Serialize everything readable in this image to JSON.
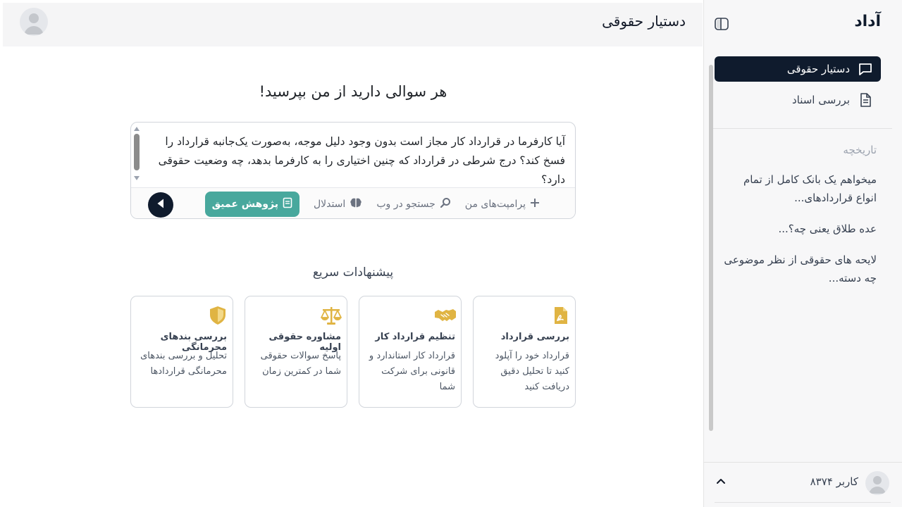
{
  "sidebar": {
    "brand": "آداد",
    "nav": [
      {
        "label": "دستیار حقوقی",
        "icon": "chat-icon",
        "active": true
      },
      {
        "label": "بررسی اسناد",
        "icon": "document-icon",
        "active": false
      }
    ],
    "history_title": "تاریخچه",
    "history": [
      "میخواهم یک بانک کامل از تمام انواع قراردادهای...",
      "عده طلاق یعنی چه؟...",
      "لایحه های حقوقی از نظر موضوعی چه دسته..."
    ],
    "user": {
      "name": "کاربر ۸۳۷۴"
    }
  },
  "header": {
    "title": "دستیار حقوقی"
  },
  "main": {
    "heading": "هر سوالی دارید از من بپرسید!",
    "composer": {
      "text": "آیا کارفرما در قرارداد کار مجاز است بدون وجود دلیل موجه، به‌صورت یک‌جانبه قرارداد را فسخ کند؟ درج شرطی در قرارداد که چنین اختیاری را به کارفرما بدهد، چه وضعیت حقوقی دارد؟",
      "tools": {
        "prompts": "پرامپت‌های من",
        "web_search": "جستجو در وب",
        "reasoning": "استدلال",
        "deep_research": "پژوهش عمیق"
      }
    },
    "quick_title": "پیشنهادات سریع",
    "cards": [
      {
        "title": "بررسی قرارداد",
        "desc": "قرارداد خود را آپلود کنید تا تحلیل دقیق دریافت کنید",
        "icon": "pdf-file-icon"
      },
      {
        "title": "تنظیم قرارداد کار",
        "desc": "قرارداد کار استاندارد و قانونی برای شرکت شما",
        "icon": "handshake-icon"
      },
      {
        "title": "مشاوره حقوقی اولیه",
        "desc": "پاسخ سوالات حقوقی شما در کمترین زمان",
        "icon": "scales-icon"
      },
      {
        "title": "بررسی بندهای محرمانگی",
        "desc": "تحلیل و بررسی بندهای محرمانگی قراردادها",
        "icon": "shield-icon"
      }
    ]
  },
  "colors": {
    "primary": "#0f1b2d",
    "accent_teal": "#48a89d",
    "icon_gold": "#e0b443"
  }
}
